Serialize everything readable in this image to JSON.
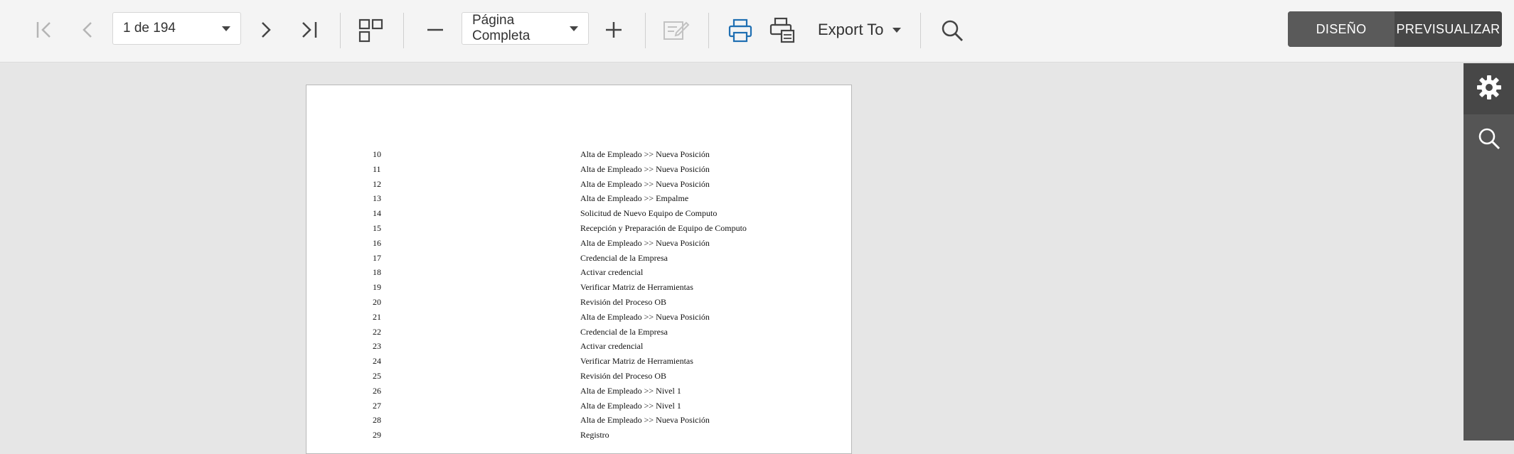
{
  "toolbar": {
    "page_selector": {
      "value": "1 de 194"
    },
    "zoom_selector": {
      "value": "Página Completa"
    },
    "export_label": "Export To",
    "mode": {
      "design": "DISEÑO",
      "preview": "PREVISUALIZAR",
      "active": "preview"
    }
  },
  "colors": {
    "toolbar_bg": "#f4f4f4",
    "canvas_bg": "#e6e6e6",
    "side_panel_bg": "#555555",
    "print_icon_accent": "#1f6fb2"
  },
  "side_panel": {
    "items": [
      {
        "icon": "gear-icon",
        "active": true
      },
      {
        "icon": "search-icon",
        "active": false
      }
    ]
  },
  "report_page": {
    "rows": [
      {
        "num": "10",
        "desc": "Alta de Empleado >> Nueva Posición"
      },
      {
        "num": "11",
        "desc": "Alta de Empleado >> Nueva Posición"
      },
      {
        "num": "12",
        "desc": "Alta de Empleado >> Nueva Posición"
      },
      {
        "num": "13",
        "desc": "Alta de Empleado >> Empalme"
      },
      {
        "num": "14",
        "desc": "Solicitud de Nuevo Equipo de Computo"
      },
      {
        "num": "15",
        "desc": "Recepción y Preparación de Equipo de Computo"
      },
      {
        "num": "16",
        "desc": "Alta de Empleado >> Nueva Posición"
      },
      {
        "num": "17",
        "desc": "Credencial de la Empresa"
      },
      {
        "num": "18",
        "desc": "Activar credencial"
      },
      {
        "num": "19",
        "desc": "Verificar Matriz de Herramientas"
      },
      {
        "num": "20",
        "desc": "Revisión del Proceso OB"
      },
      {
        "num": "21",
        "desc": "Alta de Empleado >> Nueva Posición"
      },
      {
        "num": "22",
        "desc": "Credencial de la Empresa"
      },
      {
        "num": "23",
        "desc": "Activar credencial"
      },
      {
        "num": "24",
        "desc": "Verificar Matriz de Herramientas"
      },
      {
        "num": "25",
        "desc": "Revisión del Proceso OB"
      },
      {
        "num": "26",
        "desc": "Alta de Empleado >> Nivel 1"
      },
      {
        "num": "27",
        "desc": "Alta de Empleado >> Nivel 1"
      },
      {
        "num": "28",
        "desc": "Alta de Empleado >> Nueva Posición"
      },
      {
        "num": "29",
        "desc": "Registro"
      }
    ]
  }
}
